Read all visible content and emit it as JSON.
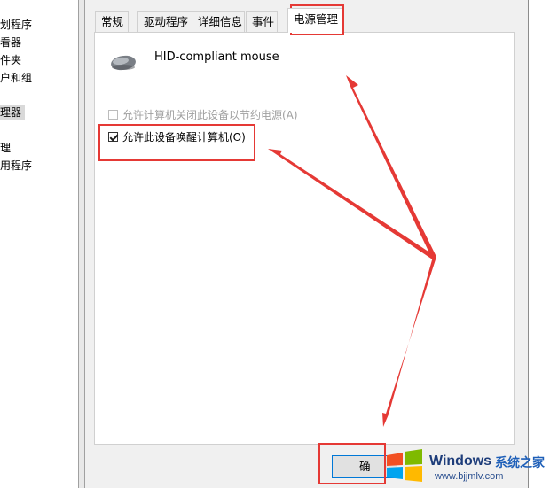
{
  "left_tree": {
    "items": [
      {
        "label": "划程序"
      },
      {
        "label": "看器"
      },
      {
        "label": "件夹"
      },
      {
        "label": "户和组"
      },
      {
        "label": "理器",
        "selected": true
      },
      {
        "label": "理"
      },
      {
        "label": "用程序"
      }
    ]
  },
  "dialog": {
    "tabs": [
      {
        "label": "常规"
      },
      {
        "label": "驱动程序"
      },
      {
        "label": "详细信息"
      },
      {
        "label": "事件"
      },
      {
        "label": "电源管理",
        "active": true
      }
    ],
    "device": {
      "name": "HID-compliant mouse",
      "icon": "mouse-icon"
    },
    "options": [
      {
        "label": "允许计算机关闭此设备以节约电源(A)",
        "checked": false,
        "disabled": true
      },
      {
        "label": "允许此设备唤醒计算机(O)",
        "checked": true,
        "disabled": false
      }
    ],
    "ok_button": {
      "label": "确"
    }
  },
  "annotation": {
    "color": "#e53935"
  },
  "watermark": {
    "brand": "Windows",
    "site": "系统之家",
    "url": "www.bjjmlv.com"
  }
}
